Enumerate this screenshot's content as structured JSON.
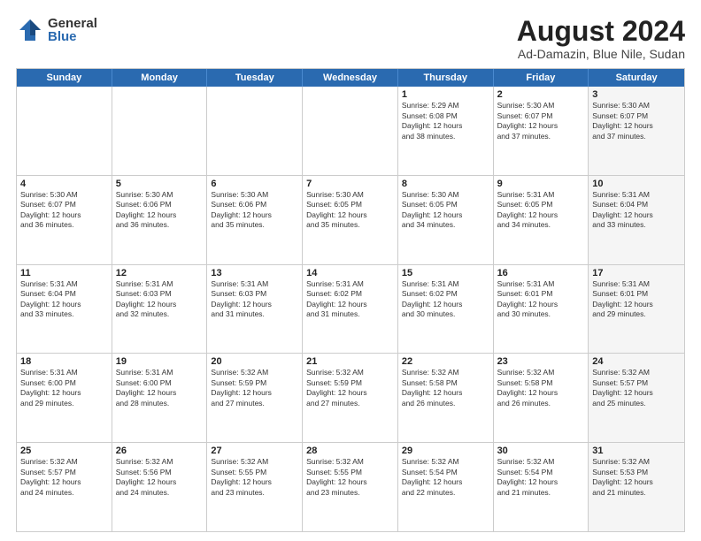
{
  "logo": {
    "general": "General",
    "blue": "Blue"
  },
  "title": {
    "month": "August 2024",
    "location": "Ad-Damazin, Blue Nile, Sudan"
  },
  "weekdays": [
    "Sunday",
    "Monday",
    "Tuesday",
    "Wednesday",
    "Thursday",
    "Friday",
    "Saturday"
  ],
  "weeks": [
    [
      {
        "day": "",
        "info": "",
        "shaded": false
      },
      {
        "day": "",
        "info": "",
        "shaded": false
      },
      {
        "day": "",
        "info": "",
        "shaded": false
      },
      {
        "day": "",
        "info": "",
        "shaded": false
      },
      {
        "day": "1",
        "info": "Sunrise: 5:29 AM\nSunset: 6:08 PM\nDaylight: 12 hours\nand 38 minutes.",
        "shaded": false
      },
      {
        "day": "2",
        "info": "Sunrise: 5:30 AM\nSunset: 6:07 PM\nDaylight: 12 hours\nand 37 minutes.",
        "shaded": false
      },
      {
        "day": "3",
        "info": "Sunrise: 5:30 AM\nSunset: 6:07 PM\nDaylight: 12 hours\nand 37 minutes.",
        "shaded": true
      }
    ],
    [
      {
        "day": "4",
        "info": "Sunrise: 5:30 AM\nSunset: 6:07 PM\nDaylight: 12 hours\nand 36 minutes.",
        "shaded": false
      },
      {
        "day": "5",
        "info": "Sunrise: 5:30 AM\nSunset: 6:06 PM\nDaylight: 12 hours\nand 36 minutes.",
        "shaded": false
      },
      {
        "day": "6",
        "info": "Sunrise: 5:30 AM\nSunset: 6:06 PM\nDaylight: 12 hours\nand 35 minutes.",
        "shaded": false
      },
      {
        "day": "7",
        "info": "Sunrise: 5:30 AM\nSunset: 6:05 PM\nDaylight: 12 hours\nand 35 minutes.",
        "shaded": false
      },
      {
        "day": "8",
        "info": "Sunrise: 5:30 AM\nSunset: 6:05 PM\nDaylight: 12 hours\nand 34 minutes.",
        "shaded": false
      },
      {
        "day": "9",
        "info": "Sunrise: 5:31 AM\nSunset: 6:05 PM\nDaylight: 12 hours\nand 34 minutes.",
        "shaded": false
      },
      {
        "day": "10",
        "info": "Sunrise: 5:31 AM\nSunset: 6:04 PM\nDaylight: 12 hours\nand 33 minutes.",
        "shaded": true
      }
    ],
    [
      {
        "day": "11",
        "info": "Sunrise: 5:31 AM\nSunset: 6:04 PM\nDaylight: 12 hours\nand 33 minutes.",
        "shaded": false
      },
      {
        "day": "12",
        "info": "Sunrise: 5:31 AM\nSunset: 6:03 PM\nDaylight: 12 hours\nand 32 minutes.",
        "shaded": false
      },
      {
        "day": "13",
        "info": "Sunrise: 5:31 AM\nSunset: 6:03 PM\nDaylight: 12 hours\nand 31 minutes.",
        "shaded": false
      },
      {
        "day": "14",
        "info": "Sunrise: 5:31 AM\nSunset: 6:02 PM\nDaylight: 12 hours\nand 31 minutes.",
        "shaded": false
      },
      {
        "day": "15",
        "info": "Sunrise: 5:31 AM\nSunset: 6:02 PM\nDaylight: 12 hours\nand 30 minutes.",
        "shaded": false
      },
      {
        "day": "16",
        "info": "Sunrise: 5:31 AM\nSunset: 6:01 PM\nDaylight: 12 hours\nand 30 minutes.",
        "shaded": false
      },
      {
        "day": "17",
        "info": "Sunrise: 5:31 AM\nSunset: 6:01 PM\nDaylight: 12 hours\nand 29 minutes.",
        "shaded": true
      }
    ],
    [
      {
        "day": "18",
        "info": "Sunrise: 5:31 AM\nSunset: 6:00 PM\nDaylight: 12 hours\nand 29 minutes.",
        "shaded": false
      },
      {
        "day": "19",
        "info": "Sunrise: 5:31 AM\nSunset: 6:00 PM\nDaylight: 12 hours\nand 28 minutes.",
        "shaded": false
      },
      {
        "day": "20",
        "info": "Sunrise: 5:32 AM\nSunset: 5:59 PM\nDaylight: 12 hours\nand 27 minutes.",
        "shaded": false
      },
      {
        "day": "21",
        "info": "Sunrise: 5:32 AM\nSunset: 5:59 PM\nDaylight: 12 hours\nand 27 minutes.",
        "shaded": false
      },
      {
        "day": "22",
        "info": "Sunrise: 5:32 AM\nSunset: 5:58 PM\nDaylight: 12 hours\nand 26 minutes.",
        "shaded": false
      },
      {
        "day": "23",
        "info": "Sunrise: 5:32 AM\nSunset: 5:58 PM\nDaylight: 12 hours\nand 26 minutes.",
        "shaded": false
      },
      {
        "day": "24",
        "info": "Sunrise: 5:32 AM\nSunset: 5:57 PM\nDaylight: 12 hours\nand 25 minutes.",
        "shaded": true
      }
    ],
    [
      {
        "day": "25",
        "info": "Sunrise: 5:32 AM\nSunset: 5:57 PM\nDaylight: 12 hours\nand 24 minutes.",
        "shaded": false
      },
      {
        "day": "26",
        "info": "Sunrise: 5:32 AM\nSunset: 5:56 PM\nDaylight: 12 hours\nand 24 minutes.",
        "shaded": false
      },
      {
        "day": "27",
        "info": "Sunrise: 5:32 AM\nSunset: 5:55 PM\nDaylight: 12 hours\nand 23 minutes.",
        "shaded": false
      },
      {
        "day": "28",
        "info": "Sunrise: 5:32 AM\nSunset: 5:55 PM\nDaylight: 12 hours\nand 23 minutes.",
        "shaded": false
      },
      {
        "day": "29",
        "info": "Sunrise: 5:32 AM\nSunset: 5:54 PM\nDaylight: 12 hours\nand 22 minutes.",
        "shaded": false
      },
      {
        "day": "30",
        "info": "Sunrise: 5:32 AM\nSunset: 5:54 PM\nDaylight: 12 hours\nand 21 minutes.",
        "shaded": false
      },
      {
        "day": "31",
        "info": "Sunrise: 5:32 AM\nSunset: 5:53 PM\nDaylight: 12 hours\nand 21 minutes.",
        "shaded": true
      }
    ]
  ]
}
